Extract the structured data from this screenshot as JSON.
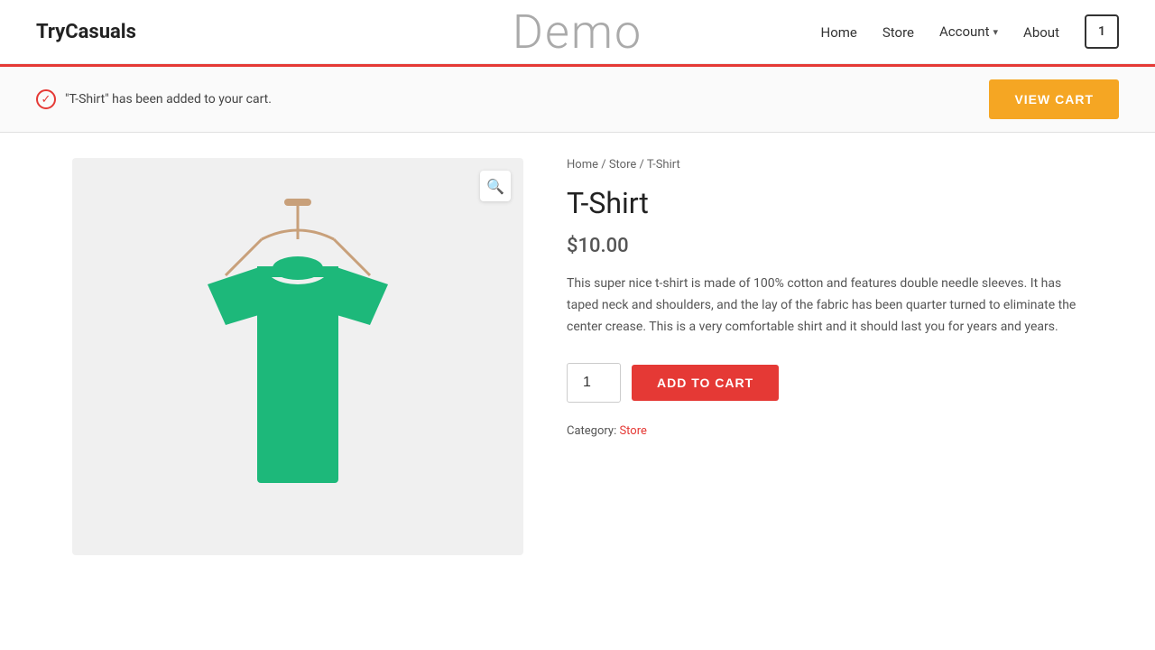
{
  "site": {
    "logo": "TryCasuals",
    "demo_title": "Demo"
  },
  "nav": {
    "home": "Home",
    "store": "Store",
    "account": "Account",
    "about": "About",
    "cart_count": "1"
  },
  "notice": {
    "message": "\"T-Shirt\" has been added to your cart.",
    "view_cart_label": "VIEW CART"
  },
  "breadcrumb": {
    "home": "Home",
    "store": "Store",
    "current": "T-Shirt",
    "separator": "/"
  },
  "product": {
    "title": "T-Shirt",
    "price": "$10.00",
    "description": "This super nice t-shirt is made of 100% cotton and features double needle sleeves. It has taped neck and shoulders, and the lay of the fabric has been quarter turned to eliminate the center crease. This is a very comfortable shirt and it should last you for years and years.",
    "quantity": "1",
    "add_to_cart_label": "ADD TO CART",
    "category_label": "Category:",
    "category": "Store"
  },
  "icons": {
    "zoom": "🔍",
    "check": "✓",
    "chevron_down": "▾",
    "cart": "1"
  }
}
